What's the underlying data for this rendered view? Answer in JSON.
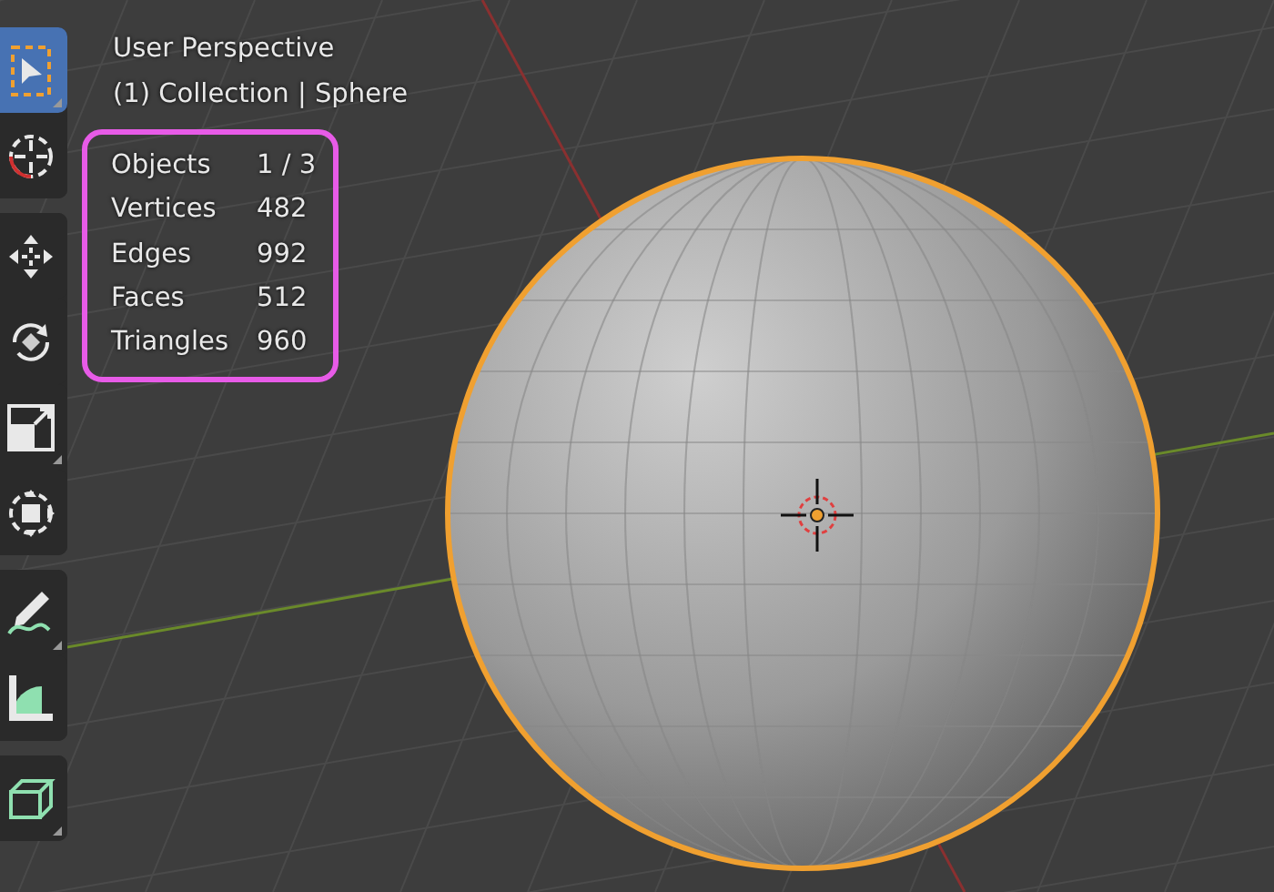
{
  "viewport": {
    "view_name": "User Perspective",
    "context": "(1) Collection | Sphere"
  },
  "stats": [
    {
      "label": "Objects",
      "value": "1 / 3"
    },
    {
      "label": "Vertices",
      "value": "482"
    },
    {
      "label": "Edges",
      "value": "992"
    },
    {
      "label": "Faces",
      "value": "512"
    },
    {
      "label": "Triangles",
      "value": "960"
    }
  ],
  "toolbar": [
    {
      "tools": [
        {
          "kind": "select",
          "selected": true,
          "submenu": true
        },
        {
          "kind": "cursor",
          "selected": false,
          "submenu": false
        }
      ]
    },
    {
      "tools": [
        {
          "kind": "move",
          "selected": false,
          "submenu": false
        },
        {
          "kind": "rotate",
          "selected": false,
          "submenu": false
        },
        {
          "kind": "scale",
          "selected": false,
          "submenu": true
        },
        {
          "kind": "transform",
          "selected": false,
          "submenu": false
        }
      ]
    },
    {
      "tools": [
        {
          "kind": "annotate",
          "selected": false,
          "submenu": true
        },
        {
          "kind": "measure",
          "selected": false,
          "submenu": false
        }
      ]
    },
    {
      "tools": [
        {
          "kind": "add_cube",
          "selected": false,
          "submenu": true
        }
      ]
    }
  ]
}
